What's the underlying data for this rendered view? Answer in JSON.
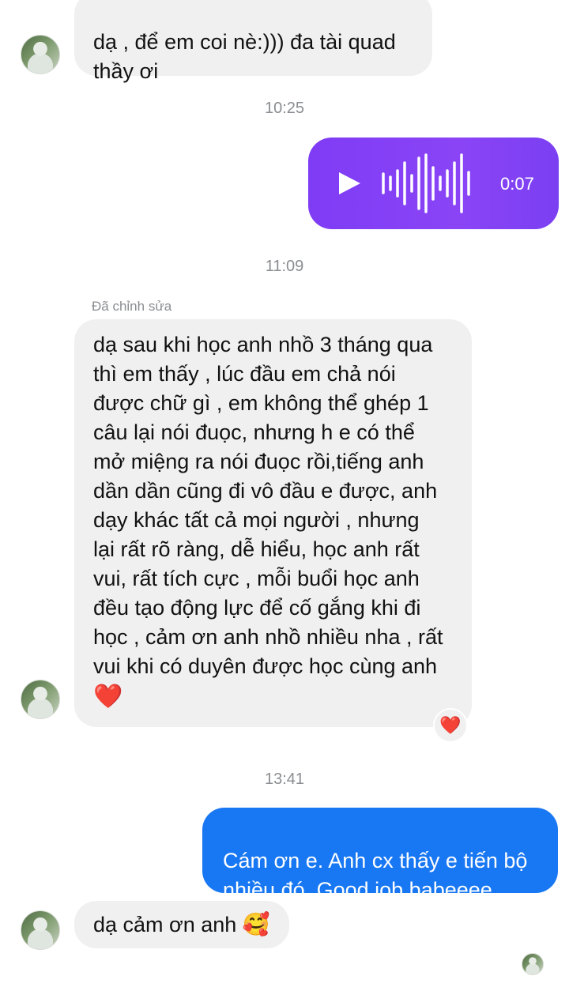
{
  "messages": {
    "m1": {
      "text": "dạ , để em coi nè:))) đa tài quad\nthầy ơi"
    },
    "m2": {
      "text": "dạ sau khi học anh nhồ 3 tháng qua\nthì em thấy , lúc đầu em chả nói\nđược chữ gì , em không thể ghép 1\ncâu lại nói đuọc, nhưng h e có thể\nmở miệng ra nói đuọc rồi,tiếng anh\ndần dần cũng đi vô đầu e được, anh\ndạy khác tất cả mọi người , nhưng\nlại rất rõ ràng, dễ hiểu,  học anh rất\nvui, rất tích cực , mỗi buổi học anh\nđều tạo động lực để cố gắng khi đi\nhọc , cảm ơn anh nhồ nhiều nha , rất\nvui khi có duyên được học cùng anh",
      "emoji": "❤️",
      "edited_label": "Đã chỉnh sửa",
      "reaction": "❤️"
    },
    "m3": {
      "text": "Cám ơn e. Anh cx thấy e tiến bộ\nnhiều đó. Good job babeeee"
    },
    "m4": {
      "text": "dạ cảm ơn anh",
      "emoji": "🥰"
    }
  },
  "timestamps": {
    "t1": "10:25",
    "t2": "11:09",
    "t3": "13:41"
  },
  "voice": {
    "duration": "0:07",
    "play_icon": "play-icon",
    "wave_icon": "waveform-icon"
  },
  "colors": {
    "outgoing": "#1877f2",
    "incoming": "#f0f0f0",
    "voice": "#7f3cf5"
  }
}
